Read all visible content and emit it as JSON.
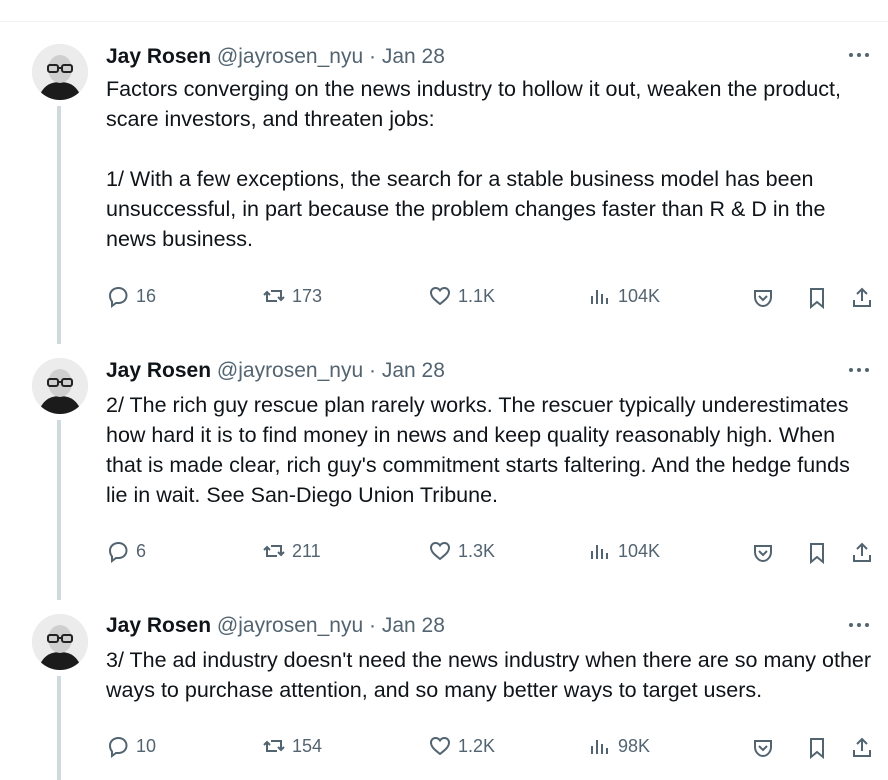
{
  "thread": [
    {
      "author": "Jay Rosen",
      "handle": "@jayrosen_nyu",
      "sep": "·",
      "date": "Jan 28",
      "text": "Factors converging on the news industry to hollow it out, weaken the product, scare investors, and threaten jobs:\n\n1/ With a few exceptions, the search for a stable business model has been unsuccessful, in part because the problem changes faster than R & D in the news business.",
      "replies": "16",
      "reposts": "173",
      "likes": "1.1K",
      "views": "104K"
    },
    {
      "author": "Jay Rosen",
      "handle": "@jayrosen_nyu",
      "sep": "·",
      "date": "Jan 28",
      "text": "2/ The rich guy rescue plan rarely works. The rescuer typically underestimates how hard it is to find money in news and keep quality reasonably high. When that is made clear, rich guy's commitment starts faltering. And the hedge funds lie in wait. See San-Diego Union Tribune.",
      "replies": "6",
      "reposts": "211",
      "likes": "1.3K",
      "views": "104K"
    },
    {
      "author": "Jay Rosen",
      "handle": "@jayrosen_nyu",
      "sep": "·",
      "date": "Jan 28",
      "text": "3/ The ad industry doesn't need the news industry when there are so many other ways to purchase attention, and so many better ways to target users.",
      "replies": "10",
      "reposts": "154",
      "likes": "1.2K",
      "views": "98K"
    }
  ],
  "icons": {
    "reply": "reply-icon",
    "repost": "repost-icon",
    "like": "heart-icon",
    "views": "views-chart-icon",
    "save": "pocket-save-icon",
    "bookmark": "bookmark-icon",
    "share": "share-icon",
    "more": "more-dots-icon"
  }
}
